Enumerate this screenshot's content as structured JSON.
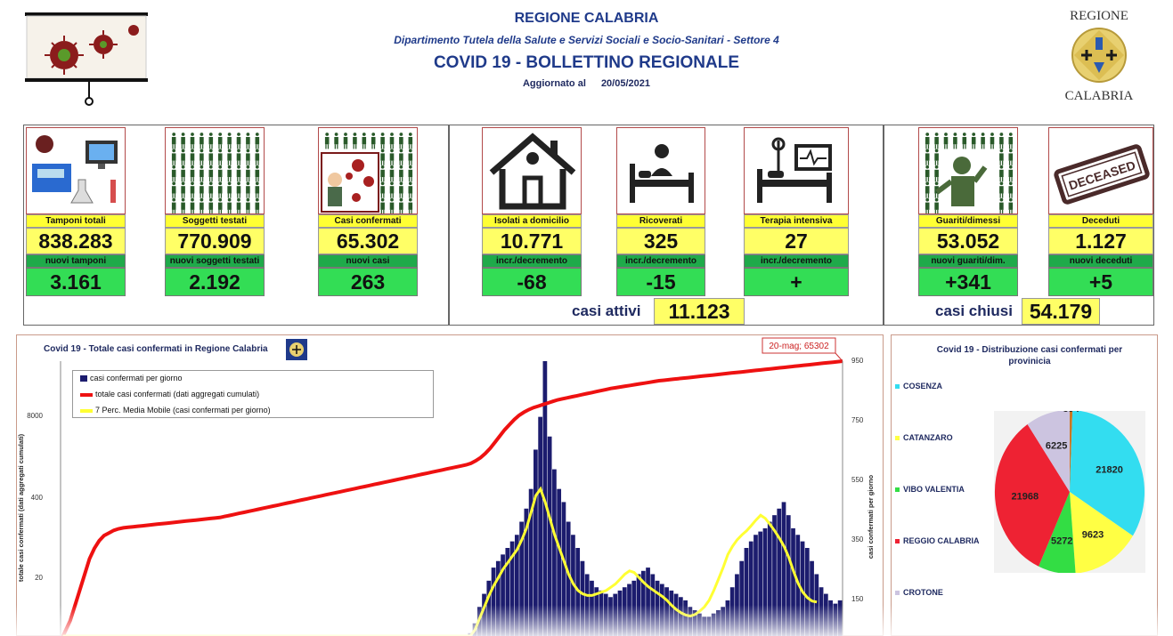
{
  "header": {
    "region": "REGIONE CALABRIA",
    "department": "Dipartimento Tutela della Salute e Servizi Sociali e Socio-Sanitari - Settore 4",
    "bulletin_title": "COVID 19 - BOLLETTINO REGIONALE",
    "updated_label": "Aggiornato al",
    "updated_date": "20/05/2021",
    "coat_top": "REGIONE",
    "coat_bottom": "CALABRIA"
  },
  "stats": [
    {
      "label": "Tamponi totali",
      "value": "838.283",
      "sub_label": "nuovi tamponi",
      "sub_value": "3.161",
      "icon": "lab-test-icon"
    },
    {
      "label": "Soggetti testati",
      "value": "770.909",
      "sub_label": "nuovi soggetti testati",
      "sub_value": "2.192",
      "icon": "people-grid-icon"
    },
    {
      "label": "Casi confermati",
      "value": "65.302",
      "sub_label": "nuovi casi",
      "sub_value": "263",
      "icon": "infection-icon"
    },
    {
      "label": "Isolati a domicilio",
      "value": "10.771",
      "sub_label": "incr./decremento",
      "sub_value": "-68",
      "icon": "house-icon"
    },
    {
      "label": "Ricoverati",
      "value": "325",
      "sub_label": "incr./decremento",
      "sub_value": "-15",
      "icon": "hospital-bed-icon"
    },
    {
      "label": "Terapia intensiva",
      "value": "27",
      "sub_label": "incr./decremento",
      "sub_value": "+",
      "icon": "icu-bed-icon"
    },
    {
      "label": "Guariti/dimessi",
      "value": "53.052",
      "sub_label": "nuovi guariti/dim.",
      "sub_value": "+341",
      "icon": "recovered-icon"
    },
    {
      "label": "Deceduti",
      "value": "1.127",
      "sub_label": "nuovi deceduti",
      "sub_value": "+5",
      "icon": "deceased-stamp-icon"
    }
  ],
  "deceased_stamp_text": "DECEASED",
  "summary": {
    "active_label": "casi attivi",
    "active_value": "11.123",
    "closed_label": "casi chiusi",
    "closed_value": "54.179"
  },
  "colors": {
    "bars": "#1c1c6e",
    "cumulative_line": "#ee1111",
    "moving_average": "#ffff33",
    "cosenza": "#33ddf0",
    "catanzaro": "#ffff44",
    "vibo_valentia": "#33dd44",
    "reggio_calabria": "#ee2233",
    "crotone": "#ccc4e0"
  },
  "chart_data": [
    {
      "type": "bar",
      "title": "Covid 19 - Totale casi confermati in Regione Calabria",
      "ylabel": "totale casi confermati (dati aggregati cumulati)",
      "y2label": "casi confermati per giorno",
      "left_ticks": [
        "8000",
        "400",
        "20"
      ],
      "right_ticks": [
        "950",
        "750",
        "550",
        "350",
        "150"
      ],
      "annotation": "20-mag; 65302",
      "legend": [
        "casi confermati per giorno",
        "totale casi confermati (dati aggregati cumulati)",
        "7 Perc. Media Mobile (casi confermati per giorno)"
      ],
      "daily_cases_profile": [
        0,
        0,
        0,
        0,
        0,
        2,
        4,
        40,
        60,
        30,
        10,
        5,
        0,
        0,
        0,
        0,
        0,
        0,
        0,
        0,
        0,
        0,
        0,
        0,
        0,
        0,
        0,
        0,
        0,
        0,
        0,
        0,
        0,
        0,
        0,
        0,
        0,
        0,
        0,
        0,
        0,
        0,
        0,
        0,
        0,
        0,
        0,
        0,
        0,
        0,
        0,
        0,
        0,
        0,
        0,
        0,
        0,
        0,
        0,
        0,
        0,
        0,
        0,
        0,
        0,
        0,
        0,
        0,
        0,
        0,
        0,
        0,
        0,
        0,
        0,
        0,
        0,
        0,
        0,
        0,
        0,
        5,
        10,
        20,
        40,
        60,
        90,
        120,
        150,
        200,
        240,
        280,
        320,
        340,
        360,
        380,
        400,
        420,
        460,
        500,
        560,
        680,
        780,
        950,
        720,
        620,
        560,
        520,
        460,
        420,
        380,
        340,
        300,
        280,
        260,
        250,
        240,
        230,
        240,
        250,
        260,
        270,
        280,
        300,
        310,
        320,
        300,
        280,
        270,
        260,
        250,
        240,
        230,
        220,
        200,
        190,
        180,
        170,
        170,
        180,
        190,
        200,
        220,
        260,
        300,
        340,
        380,
        400,
        420,
        430,
        440,
        460,
        480,
        500,
        520,
        480,
        440,
        420,
        400,
        380,
        340,
        300,
        260,
        240,
        220,
        210,
        220
      ],
      "moving_average_profile": [
        0,
        0,
        0,
        0,
        0,
        3,
        10,
        20,
        25,
        20,
        12,
        6,
        2,
        0,
        0,
        0,
        0,
        0,
        0,
        0,
        0,
        0,
        0,
        0,
        0,
        0,
        0,
        0,
        0,
        0,
        0,
        0,
        0,
        0,
        0,
        0,
        0,
        0,
        0,
        0,
        0,
        0,
        0,
        0,
        0,
        0,
        0,
        0,
        0,
        0,
        0,
        0,
        0,
        0,
        0,
        0,
        0,
        0,
        0,
        0,
        0,
        0,
        0,
        0,
        0,
        0,
        0,
        0,
        0,
        0,
        0,
        0,
        0,
        0,
        0,
        0,
        0,
        0,
        0,
        0,
        0,
        3,
        8,
        16,
        30,
        50,
        75,
        100,
        130,
        165,
        200,
        235,
        265,
        290,
        315,
        335,
        355,
        375,
        405,
        440,
        490,
        540,
        560,
        520,
        470,
        420,
        380,
        340,
        300,
        270,
        250,
        240,
        235,
        235,
        240,
        245,
        250,
        260,
        270,
        285,
        300,
        310,
        305,
        290,
        275,
        262,
        252,
        242,
        232,
        220,
        205,
        192,
        182,
        175,
        172,
        177,
        187,
        200,
        220,
        250,
        285,
        320,
        360,
        385,
        405,
        420,
        432,
        448,
        465,
        480,
        470,
        452,
        432,
        410,
        385,
        352,
        310,
        272,
        245,
        228,
        218,
        215
      ],
      "cumulative_profile": [
        0,
        200,
        400,
        700,
        1000,
        1300,
        1600,
        1800,
        1950,
        2050,
        2100,
        2150,
        2180,
        2200,
        2210,
        2220,
        2230,
        2240,
        2250,
        2260,
        2270,
        2280,
        2290,
        2300,
        2310,
        2320,
        2330,
        2340,
        2350,
        2360,
        2370,
        2380,
        2390,
        2400,
        2420,
        2440,
        2460,
        2480,
        2500,
        2520,
        2540,
        2560,
        2580,
        2600,
        2620,
        2640,
        2660,
        2680,
        2700,
        2720,
        2740,
        2760,
        2780,
        2800,
        2820,
        2840,
        2860,
        2880,
        2900,
        2920,
        2940,
        2960,
        2980,
        3000,
        3020,
        3040,
        3060,
        3080,
        3100,
        3120,
        3140,
        3160,
        3180,
        3200,
        3220,
        3240,
        3260,
        3280,
        3300,
        3320,
        3340,
        3360,
        3380,
        3400,
        3420,
        3450,
        3500,
        3560,
        3640,
        3740,
        3860,
        3980,
        4100,
        4200,
        4300,
        4380,
        4440,
        4490,
        4530,
        4560,
        4590,
        4620,
        4650,
        4680,
        4700,
        4720,
        4740,
        4760,
        4780,
        4800,
        4820,
        4840,
        4860,
        4880,
        4900,
        4915,
        4930,
        4945,
        4960,
        4975,
        4990,
        5005,
        5020,
        5035,
        5050,
        5060,
        5070,
        5080,
        5090,
        5100,
        5110,
        5120,
        5130,
        5140,
        5150,
        5160,
        5170,
        5180,
        5190,
        5200,
        5210,
        5220,
        5230,
        5240,
        5250,
        5260,
        5270,
        5280,
        5290,
        5300,
        5310,
        5320,
        5330,
        5340,
        5350,
        5360,
        5370,
        5380,
        5390,
        5400,
        5410,
        5420,
        5430
      ],
      "cumulative_max": 5430,
      "daily_max": 950
    },
    {
      "type": "pie",
      "title": "Covid 19 - Distribuzione casi confermati per provinicia",
      "slices": [
        {
          "name": "COSENZA",
          "value": 21820
        },
        {
          "name": "CATANZARO",
          "value": 9623
        },
        {
          "name": "VIBO VALENTIA",
          "value": 5272
        },
        {
          "name": "REGGIO CALABRIA",
          "value": 21968
        },
        {
          "name": "CROTONE",
          "value": 6225
        },
        {
          "name": "",
          "value": 394
        }
      ]
    }
  ]
}
